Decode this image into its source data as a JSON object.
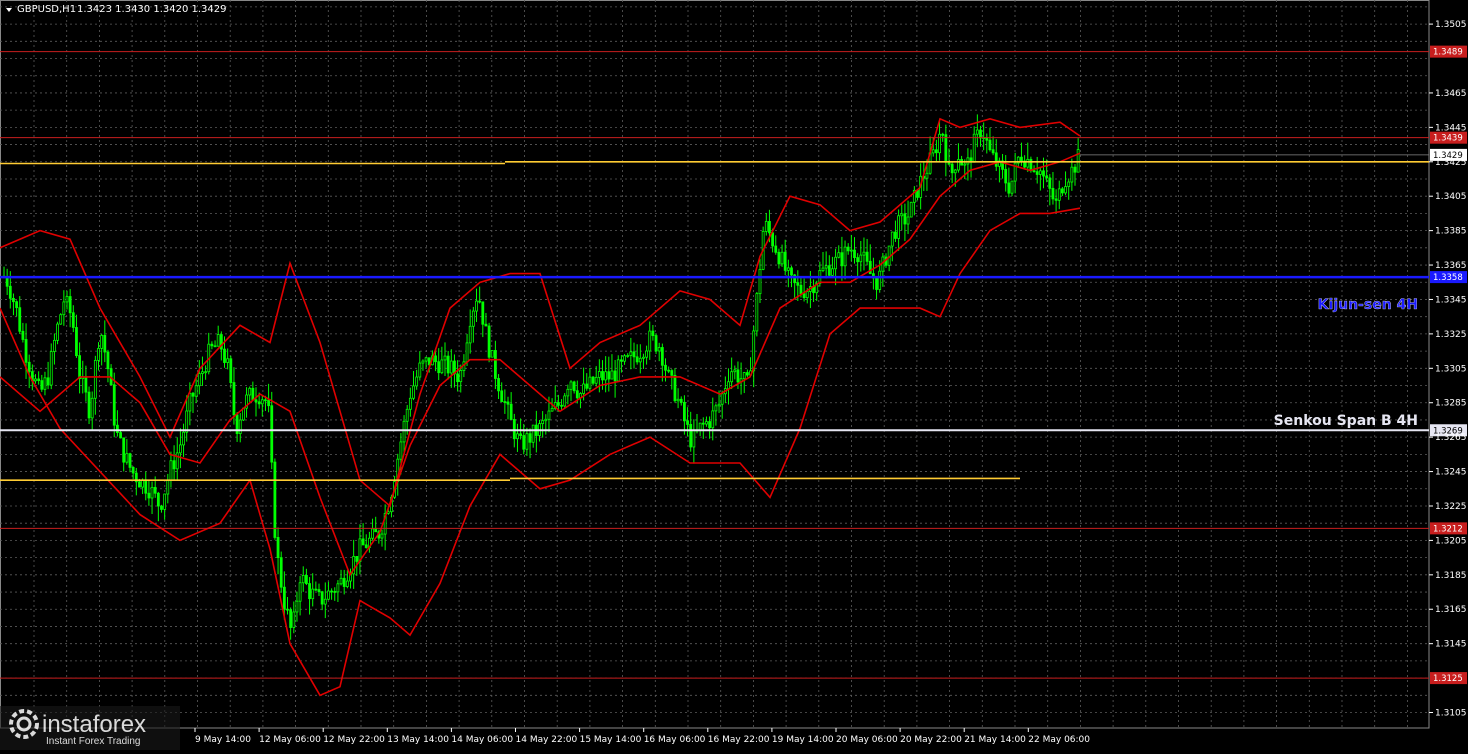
{
  "header": {
    "symbol": "GBPUSD,H1",
    "ohlc": "1.3423 1.3430 1.3420 1.3429"
  },
  "watermark": {
    "brand": "instaforex",
    "tagline": "Instant Forex Trading"
  },
  "colors": {
    "background": "#000000",
    "grid": "#5c5c5c",
    "candle": "#00ff00",
    "ichimoku_line": "#e00000",
    "support_resistance": "#c81e1e",
    "senkou_a": "#ffcc33",
    "kijun_4h": "#1a1aff",
    "senkou_b_4h": "#e6e6f2",
    "axis_text": "#ffffff"
  },
  "chart_data": {
    "type": "candlestick",
    "symbol": "GBPUSD",
    "timeframe": "H1",
    "ylim": [
      1.3096,
      1.3519
    ],
    "y_ticks": [
      "1.3505",
      "1.3465",
      "1.3445",
      "1.3425",
      "1.3405",
      "1.3385",
      "1.3365",
      "1.3345",
      "1.3325",
      "1.3305",
      "1.3285",
      "1.3265",
      "1.3245",
      "1.3225",
      "1.3205",
      "1.3185",
      "1.3165",
      "1.3145",
      "1.3105"
    ],
    "x_labels": [
      "9 May 14:00",
      "12 May 06:00",
      "12 May 22:00",
      "13 May 14:00",
      "14 May 06:00",
      "14 May 22:00",
      "15 May 14:00",
      "16 May 06:00",
      "16 May 22:00",
      "19 May 14:00",
      "20 May 06:00",
      "20 May 22:00",
      "21 May 14:00",
      "22 May 06:00"
    ],
    "levels": [
      {
        "price": 1.3489,
        "label": "1.3489",
        "kind": "resistance"
      },
      {
        "price": 1.3439,
        "label": "1.3439",
        "kind": "resistance"
      },
      {
        "price": 1.3358,
        "label": "1.3358",
        "kind": "kijun-sen 4H"
      },
      {
        "price": 1.3269,
        "label": "1.3269",
        "kind": "senkou span B 4H"
      },
      {
        "price": 1.3212,
        "label": "1.3212",
        "kind": "support"
      },
      {
        "price": 1.3125,
        "label": "1.3125",
        "kind": "support"
      }
    ],
    "current_price": {
      "price": 1.3429,
      "label": "1.3429"
    },
    "overlay_labels": {
      "kijun": "Kijun-sen 4H",
      "senkou": "Senkou Span B 4H"
    },
    "candle_path": [
      [
        0,
        1.3362
      ],
      [
        8,
        1.3355
      ],
      [
        16,
        1.334
      ],
      [
        24,
        1.3318
      ],
      [
        32,
        1.3302
      ],
      [
        40,
        1.329
      ],
      [
        48,
        1.33
      ],
      [
        56,
        1.3325
      ],
      [
        64,
        1.3345
      ],
      [
        72,
        1.3335
      ],
      [
        80,
        1.33
      ],
      [
        90,
        1.328
      ],
      [
        100,
        1.333
      ],
      [
        108,
        1.3305
      ],
      [
        116,
        1.3268
      ],
      [
        124,
        1.3255
      ],
      [
        132,
        1.3245
      ],
      [
        140,
        1.324
      ],
      [
        150,
        1.3235
      ],
      [
        160,
        1.3225
      ],
      [
        170,
        1.3245
      ],
      [
        180,
        1.326
      ],
      [
        190,
        1.3285
      ],
      [
        200,
        1.33
      ],
      [
        210,
        1.3315
      ],
      [
        220,
        1.332
      ],
      [
        228,
        1.3305
      ],
      [
        236,
        1.327
      ],
      [
        244,
        1.3285
      ],
      [
        252,
        1.329
      ],
      [
        260,
        1.329
      ],
      [
        268,
        1.3285
      ],
      [
        276,
        1.32
      ],
      [
        284,
        1.317
      ],
      [
        292,
        1.315
      ],
      [
        300,
        1.3185
      ],
      [
        310,
        1.3175
      ],
      [
        320,
        1.317
      ],
      [
        330,
        1.3175
      ],
      [
        340,
        1.318
      ],
      [
        350,
        1.319
      ],
      [
        360,
        1.32
      ],
      [
        370,
        1.3205
      ],
      [
        380,
        1.321
      ],
      [
        390,
        1.323
      ],
      [
        400,
        1.326
      ],
      [
        410,
        1.329
      ],
      [
        420,
        1.3305
      ],
      [
        430,
        1.331
      ],
      [
        440,
        1.3308
      ],
      [
        450,
        1.3305
      ],
      [
        460,
        1.33
      ],
      [
        470,
        1.3335
      ],
      [
        478,
        1.335
      ],
      [
        486,
        1.3325
      ],
      [
        494,
        1.3305
      ],
      [
        502,
        1.329
      ],
      [
        510,
        1.3275
      ],
      [
        520,
        1.326
      ],
      [
        530,
        1.3265
      ],
      [
        540,
        1.327
      ],
      [
        550,
        1.3278
      ],
      [
        560,
        1.3285
      ],
      [
        570,
        1.33
      ],
      [
        580,
        1.329
      ],
      [
        590,
        1.3295
      ],
      [
        600,
        1.33
      ],
      [
        610,
        1.33
      ],
      [
        620,
        1.3305
      ],
      [
        630,
        1.331
      ],
      [
        640,
        1.3315
      ],
      [
        650,
        1.3322
      ],
      [
        660,
        1.3318
      ],
      [
        668,
        1.33
      ],
      [
        676,
        1.329
      ],
      [
        684,
        1.3275
      ],
      [
        692,
        1.3262
      ],
      [
        700,
        1.327
      ],
      [
        710,
        1.3275
      ],
      [
        720,
        1.3285
      ],
      [
        730,
        1.3305
      ],
      [
        740,
        1.33
      ],
      [
        748,
        1.3295
      ],
      [
        756,
        1.334
      ],
      [
        764,
        1.339
      ],
      [
        772,
        1.338
      ],
      [
        780,
        1.337
      ],
      [
        790,
        1.3355
      ],
      [
        800,
        1.335
      ],
      [
        810,
        1.3352
      ],
      [
        820,
        1.336
      ],
      [
        830,
        1.3365
      ],
      [
        840,
        1.3368
      ],
      [
        850,
        1.3375
      ],
      [
        860,
        1.3372
      ],
      [
        870,
        1.336
      ],
      [
        878,
        1.3355
      ],
      [
        886,
        1.337
      ],
      [
        894,
        1.3385
      ],
      [
        902,
        1.339
      ],
      [
        910,
        1.3395
      ],
      [
        918,
        1.341
      ],
      [
        926,
        1.342
      ],
      [
        934,
        1.343
      ],
      [
        942,
        1.3445
      ],
      [
        950,
        1.3415
      ],
      [
        958,
        1.343
      ],
      [
        966,
        1.342
      ],
      [
        974,
        1.3435
      ],
      [
        982,
        1.3445
      ],
      [
        990,
        1.343
      ],
      [
        1000,
        1.342
      ],
      [
        1010,
        1.341
      ],
      [
        1020,
        1.343
      ],
      [
        1030,
        1.3425
      ],
      [
        1040,
        1.342
      ],
      [
        1048,
        1.341
      ],
      [
        1056,
        1.34
      ],
      [
        1064,
        1.3415
      ],
      [
        1072,
        1.342
      ],
      [
        1080,
        1.3429
      ]
    ]
  }
}
